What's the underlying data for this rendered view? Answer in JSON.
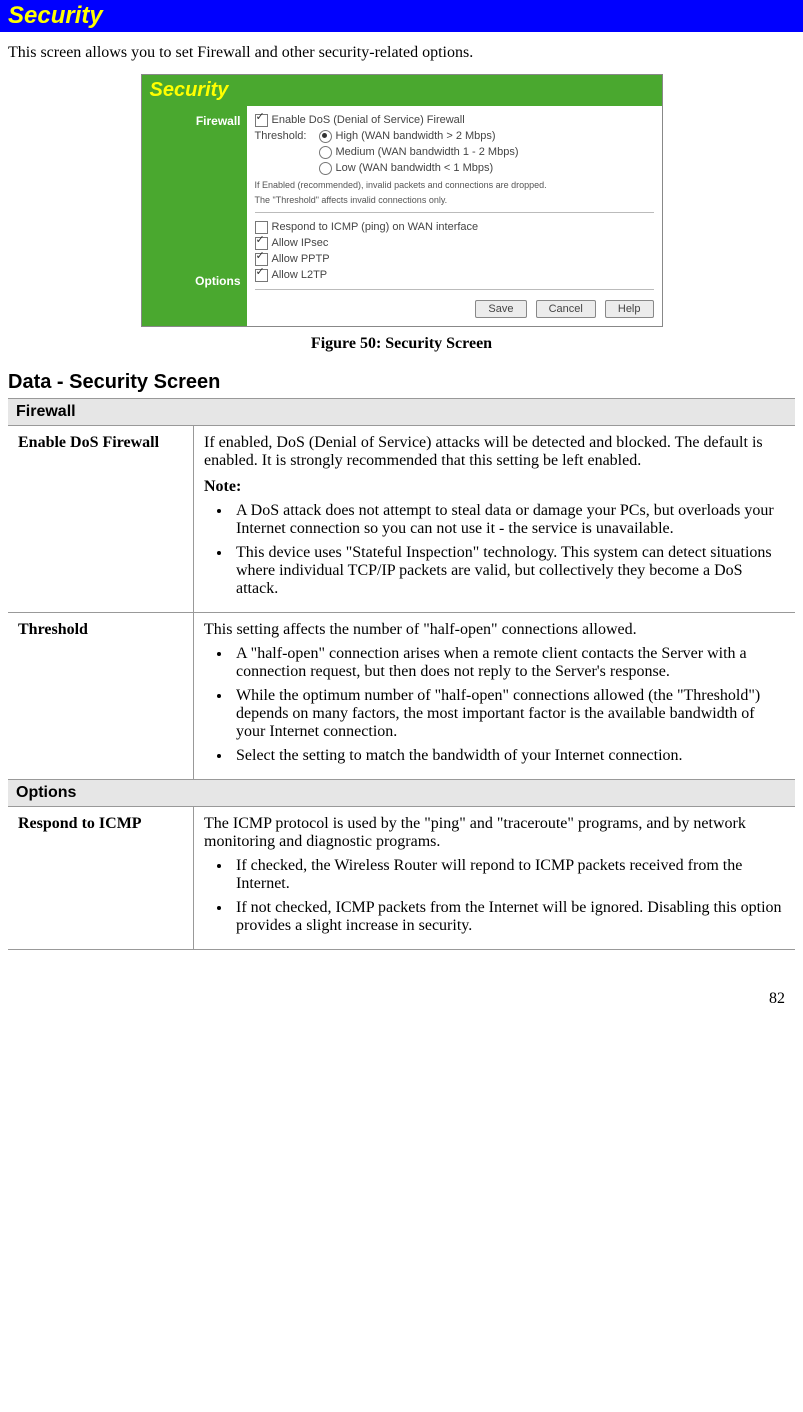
{
  "title": "Security",
  "intro": "This screen allows you to set Firewall and other security-related options.",
  "screenshot": {
    "panel_title": "Security",
    "sidebar": {
      "firewall": "Firewall",
      "options": "Options"
    },
    "firewall": {
      "enable_label": "Enable DoS (Denial of Service) Firewall",
      "threshold_label": "Threshold:",
      "threshold_high": "High (WAN bandwidth > 2 Mbps)",
      "threshold_medium": "Medium (WAN bandwidth 1 - 2 Mbps)",
      "threshold_low": "Low (WAN bandwidth < 1 Mbps)",
      "note1": "If Enabled (recommended), invalid packets and connections are dropped.",
      "note2": "The \"Threshold\" affects invalid connections only."
    },
    "options": {
      "respond_icmp": "Respond to ICMP (ping) on WAN interface",
      "allow_ipsec": "Allow IPsec",
      "allow_pptp": "Allow PPTP",
      "allow_l2tp": "Allow L2TP"
    },
    "buttons": {
      "save": "Save",
      "cancel": "Cancel",
      "help": "Help"
    }
  },
  "figure_caption": "Figure 50: Security Screen",
  "section_heading": "Data - Security Screen",
  "groups": {
    "firewall": "Firewall",
    "options": "Options"
  },
  "rows": {
    "enable_dos": {
      "label": "Enable DoS Firewall",
      "para1": "If enabled, DoS (Denial of Service) attacks will be detected and blocked. The default is enabled. It is strongly recommended that this setting be left enabled.",
      "note_label": "Note:",
      "bullet1": "A DoS attack does not attempt to steal data or damage your PCs, but overloads your Internet connection so you can not use it - the service is unavailable.",
      "bullet2": "This device uses \"Stateful Inspection\" technology. This system can detect situations where individual TCP/IP packets are valid, but collectively they become a DoS attack."
    },
    "threshold": {
      "label": "Threshold",
      "para1": "This setting affects the number of \"half-open\" connections allowed.",
      "bullet1": "A \"half-open\" connection arises when a remote client contacts the Server with a connection request, but then does not reply to the Server's response.",
      "bullet2": "While the optimum number of \"half-open\" connections allowed (the \"Threshold\") depends on many factors, the most important factor is the available bandwidth of your Internet connection.",
      "bullet3": "Select the setting to match the bandwidth of your Internet connection."
    },
    "respond_icmp": {
      "label": "Respond to ICMP",
      "para1": "The ICMP protocol is used by the \"ping\" and \"traceroute\" programs, and by network monitoring and diagnostic programs.",
      "bullet1": "If checked, the Wireless Router will repond to ICMP packets received from the Internet.",
      "bullet2": "If not checked, ICMP packets from the Internet will be ignored. Disabling this option provides a slight increase in security."
    }
  },
  "page_number": "82"
}
